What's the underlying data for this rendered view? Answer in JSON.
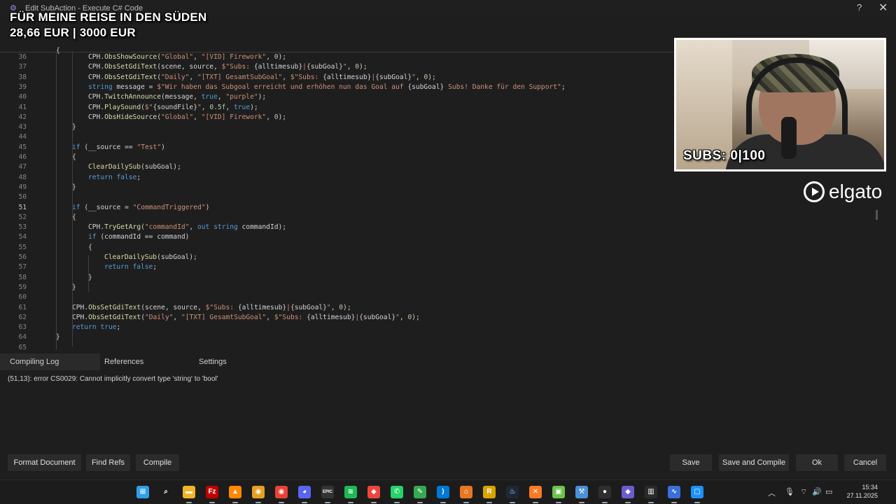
{
  "window": {
    "title": "Edit SubAction - Execute C# Code",
    "help_label": "?",
    "close_label": "✕"
  },
  "overlay": {
    "goal_line1": "FÜR MEINE REISE IN DEN SÜDEN",
    "goal_line2": "28,66 EUR | 3000 EUR",
    "subs_counter": "SUBS: 0|100",
    "brand": "elgato"
  },
  "editor": {
    "active_line": 51,
    "lines": [
      {
        "n": "36",
        "code": "CPH.ObsShowSource(\"Global\", \"[VID] Firework\", 0);"
      },
      {
        "n": "37",
        "code": "CPH.ObsSetGdiText(scene, source, $\"Subs: {alltimesub}|{subGoal}\", 0);"
      },
      {
        "n": "38",
        "code": "CPH.ObsSetGdiText(\"Daily\", \"[TXT] GesamtSubGoal\", $\"Subs: {alltimesub}|{subGoal}\", 0);"
      },
      {
        "n": "39",
        "code": "string message = $\"Wir haben das Subgoal erreicht und erhöhen nun das Goal auf {subGoal} Subs! Danke für den Support\";"
      },
      {
        "n": "40",
        "code": "CPH.TwitchAnnounce(message, true, \"purple\");"
      },
      {
        "n": "41",
        "code": "CPH.PlaySound($\"{soundFile}\", 0.5f, true);"
      },
      {
        "n": "42",
        "code": "CPH.ObsHideSource(\"Global\", \"[VID] Firework\", 0);"
      },
      {
        "n": "43",
        "code": "}"
      },
      {
        "n": "44",
        "code": ""
      },
      {
        "n": "45",
        "code": "if (__source == \"Test\")"
      },
      {
        "n": "46",
        "code": "{"
      },
      {
        "n": "47",
        "code": "ClearDailySub(subGoal);"
      },
      {
        "n": "48",
        "code": "return false;"
      },
      {
        "n": "49",
        "code": "}"
      },
      {
        "n": "50",
        "code": ""
      },
      {
        "n": "51",
        "code": "if (__source = \"CommandTriggered\")"
      },
      {
        "n": "52",
        "code": "{"
      },
      {
        "n": "53",
        "code": "CPH.TryGetArg(\"commandId\", out string commandId);"
      },
      {
        "n": "54",
        "code": "if (commandId == command)"
      },
      {
        "n": "55",
        "code": "{"
      },
      {
        "n": "56",
        "code": "ClearDailySub(subGoal);"
      },
      {
        "n": "57",
        "code": "return false;"
      },
      {
        "n": "58",
        "code": "}"
      },
      {
        "n": "59",
        "code": "}"
      },
      {
        "n": "60",
        "code": ""
      },
      {
        "n": "61",
        "code": "CPH.ObsSetGdiText(scene, source, $\"Subs: {alltimesub}|{subGoal}\", 0);"
      },
      {
        "n": "62",
        "code": "CPH.ObsSetGdiText(\"Daily\", \"[TXT] GesamtSubGoal\", $\"Subs: {alltimesub}|{subGoal}\", 0);"
      },
      {
        "n": "63",
        "code": "return true;"
      },
      {
        "n": "64",
        "code": "}"
      },
      {
        "n": "65",
        "code": ""
      }
    ],
    "first_line_partial": "{"
  },
  "tabs": [
    {
      "label": "Compiling Log",
      "active": true
    },
    {
      "label": "References",
      "active": false
    },
    {
      "label": "Settings",
      "active": false
    }
  ],
  "log": {
    "error": "(51,13): error CS0029: Cannot implicitly convert type 'string' to 'bool'"
  },
  "buttons": {
    "format": "Format Document",
    "find_refs": "Find Refs",
    "compile": "Compile",
    "save": "Save",
    "save_compile": "Save and Compile",
    "ok": "Ok",
    "cancel": "Cancel"
  },
  "taskbar": {
    "icons": [
      "windows-start",
      "search",
      "file-explorer",
      "filezilla",
      "vlc",
      "chrome-canary",
      "chrome",
      "discord",
      "epic-games",
      "spotify",
      "anydesk",
      "whatsapp",
      "notepad",
      "vscode",
      "unknown-orange",
      "rustdesk",
      "steam",
      "xampp",
      "green-cube",
      "tool",
      "obs",
      "streamerbot",
      "fl-studio",
      "waveform",
      "visual-studio"
    ],
    "clock_time": "15:34",
    "clock_date": "27.11.2025"
  }
}
